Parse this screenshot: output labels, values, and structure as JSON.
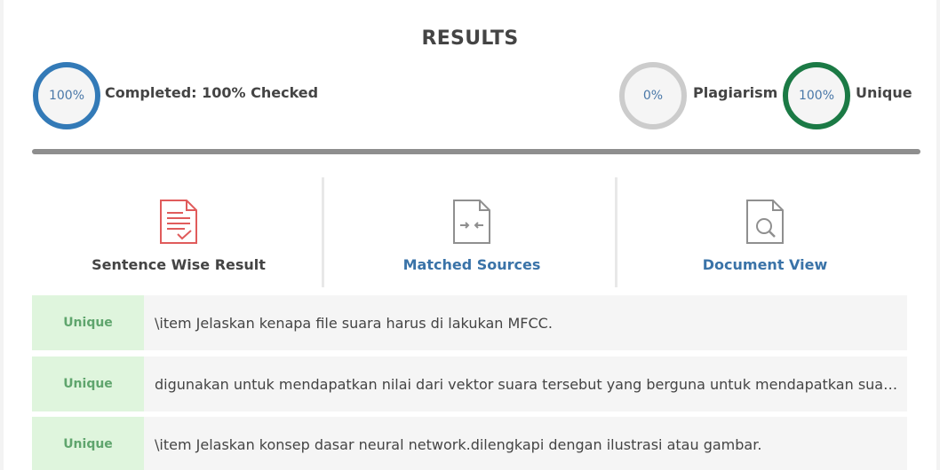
{
  "header": {
    "title": "RESULTS"
  },
  "stats": {
    "completed": {
      "percent_text": "100%",
      "label": "Completed: 100% Checked",
      "value": 100,
      "color": "#337ab7"
    },
    "plagiarism": {
      "percent_text": "0%",
      "label": "Plagiarism",
      "value": 0,
      "color": "#cccccc"
    },
    "unique": {
      "percent_text": "100%",
      "label": "Unique",
      "value": 100,
      "color": "#1b7a45"
    }
  },
  "progress": {
    "value": 100,
    "color": "#8e8e8e"
  },
  "tabs": [
    {
      "label": "Sentence Wise Result",
      "icon": "document-check-icon",
      "active": true
    },
    {
      "label": "Matched Sources",
      "icon": "document-compare-icon",
      "active": false
    },
    {
      "label": "Document View",
      "icon": "document-search-icon",
      "active": false
    }
  ],
  "results": [
    {
      "status": "Unique",
      "text": "\\item Jelaskan kenapa file suara harus di lakukan MFCC."
    },
    {
      "status": "Unique",
      "text": "digunakan untuk mendapatkan nilai dari vektor suara tersebut yang berguna untuk mendapatkan suatu ciri dari suara tersebut."
    },
    {
      "status": "Unique",
      "text": "\\item Jelaskan konsep dasar neural network.dilengkapi dengan ilustrasi atau gambar."
    }
  ],
  "colors": {
    "accent_blue": "#337ab7",
    "unique_green": "#1b7a45",
    "badge_bg": "#dff5dd",
    "badge_text": "#5fa56d",
    "icon_red": "#e05b5b",
    "link_blue": "#3a73a8"
  }
}
